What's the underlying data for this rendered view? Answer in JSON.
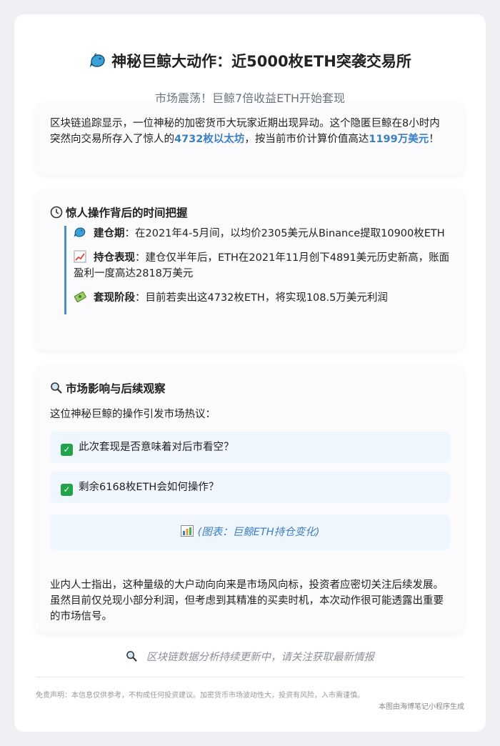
{
  "title": "神秘巨鲸大动作：近5000枚ETH突袭交易所",
  "title_icon": "whale-icon",
  "subtitle": "市场震荡！巨鲸7倍收益ETH开始套现",
  "intro": {
    "text_a": "区块链追踪显示，一位神秘的加密货币大玩家近期出现异动。这个隐匿巨鲸在8小时内突然向交易所存入了惊人的",
    "highlight_1": "4732枚以太坊",
    "text_b": "，按当前市价计算价值高达",
    "highlight_2": "1199万美元",
    "text_c": "！"
  },
  "timeline_section": {
    "icon": "clock-icon",
    "title": "惊人操作背后的时间把握",
    "items": [
      {
        "icon": "whale-icon",
        "label": "建仓期",
        "text": "：在2021年4-5月间，以均价2305美元从Binance提取10900枚ETH"
      },
      {
        "icon": "chart-up-icon",
        "label": "持仓表现",
        "text": "：建仓仅半年后，ETH在2021年11月创下4891美元历史新高，账面盈利一度高达2818万美元"
      },
      {
        "icon": "money-icon",
        "label": "套现阶段",
        "text": "：目前若卖出这4732枚ETH，将实现108.5万美元利润"
      }
    ]
  },
  "impact_section": {
    "icon": "magnifier-icon",
    "title": "市场影响与后续观察",
    "lead": "这位神秘巨鲸的操作引发市场热议：",
    "questions": [
      "此次套现是否意味着对后市看空？",
      "剩余6168枚ETH会如何操作？"
    ],
    "chart_note": "(图表：巨鲸ETH持仓变化)",
    "conclusion": "业内人士指出，这种量级的大户动向向来是市场风向标，投资者应密切关注后续发展。虽然目前仅兑现小部分利润，但考虑到其精准的买卖时机，本次动作很可能透露出重要的市场信号。"
  },
  "footer_note": "区块链数据分析持续更新中，请关注获取最新情报",
  "disclaimer": "免责声明：本信息仅供参考，不构成任何投资建议。加密货币市场波动性大，投资有风险，入市需谨慎。",
  "credit": "本图由海博笔记小程序生成",
  "colors": {
    "accent": "#3b7fc4",
    "check": "#22a34a",
    "timeline_bar": "#4a90c8"
  }
}
